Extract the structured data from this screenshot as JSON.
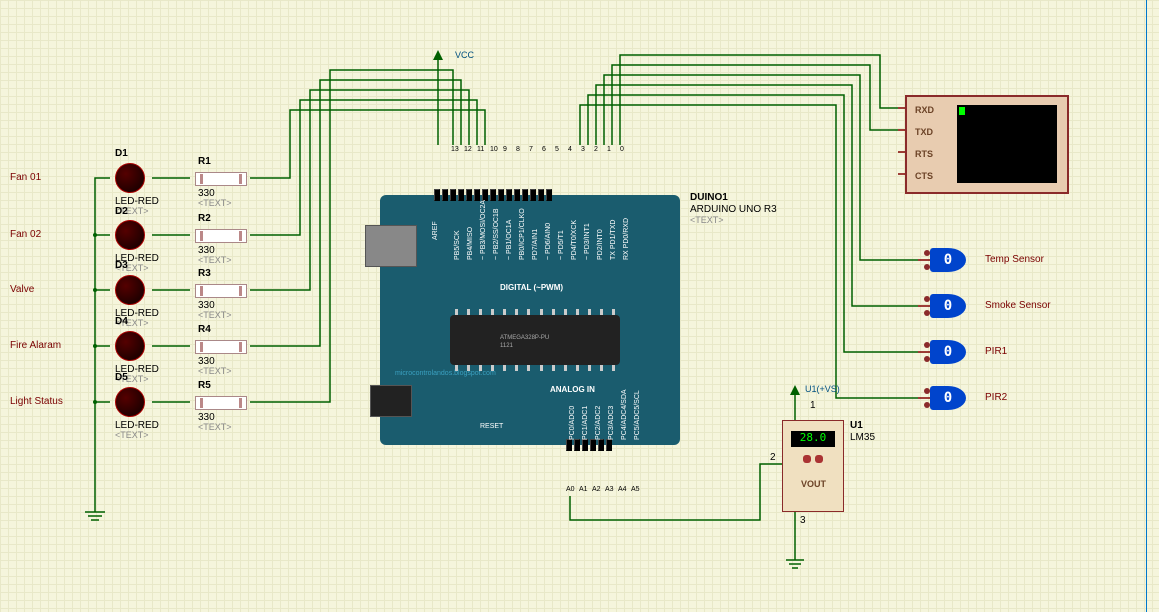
{
  "leds": [
    {
      "id": "D1",
      "tag": "LED-RED",
      "label": "Fan 01"
    },
    {
      "id": "D2",
      "tag": "LED-RED",
      "label": "Fan 02"
    },
    {
      "id": "D3",
      "tag": "LED-RED",
      "label": "Valve"
    },
    {
      "id": "D4",
      "tag": "LED-RED",
      "label": "Fire Alaram"
    },
    {
      "id": "D5",
      "tag": "LED-RED",
      "label": "Light Status"
    }
  ],
  "resistors": [
    {
      "id": "R1",
      "value": "330"
    },
    {
      "id": "R2",
      "value": "330"
    },
    {
      "id": "R3",
      "value": "330"
    },
    {
      "id": "R4",
      "value": "330"
    },
    {
      "id": "R5",
      "value": "330"
    }
  ],
  "placeholder_text": "<TEXT>",
  "vcc_label": "VCC",
  "arduino": {
    "ref": "DUINO1",
    "name": "ARDUINO UNO R3",
    "digital_title": "DIGITAL (~PWM)",
    "analog_title": "ANALOG IN",
    "credit": "microcontrolandos.blogspot.com",
    "chip_text": "ATMEGA328P-PU",
    "chip_num": "1121",
    "reset_label": "RESET",
    "aref_label": "AREF",
    "digital_pins_num": [
      "13",
      "12",
      "11",
      "10",
      "9",
      "8",
      "7",
      "6",
      "5",
      "4",
      "3",
      "2",
      "1",
      "0"
    ],
    "digital_pins_alt": [
      "PB5/SCK",
      "PB4/MISO",
      "~ PB3/MOSI/OC2A",
      "~ PB2/SS/OC1B",
      "~ PB1/OC1A",
      "PB0/ICP1/CLKO",
      "PD7/AIN1",
      "~ PD6/AIN0",
      "~ PD5/T1",
      "PD4/T0/XCK",
      "~ PD3/INT1",
      "PD2/INT0",
      "TX PD1/TXD",
      "RX PD0/RXD"
    ],
    "analog_pins": [
      "A0",
      "A1",
      "A2",
      "A3",
      "A4",
      "A5"
    ],
    "analog_alt": [
      "PC0/ADC0",
      "PC1/ADC1",
      "PC2/ADC2",
      "PC3/ADC3",
      "PC4/ADC4/SDA",
      "PC5/ADC5/SCL"
    ]
  },
  "terminal": {
    "pins": [
      "RXD",
      "TXD",
      "RTS",
      "CTS"
    ]
  },
  "logic_states": [
    "0",
    "0",
    "0",
    "0"
  ],
  "sensors": [
    "Temp Sensor",
    "Smoke Sensor",
    "PIR1",
    "PIR2"
  ],
  "lm35": {
    "ref": "U1",
    "name": "LM35",
    "value": "28.0",
    "vout": "VOUT",
    "net": "U1(+VS)",
    "pin1": "1",
    "pin2": "2",
    "pin3": "3"
  }
}
